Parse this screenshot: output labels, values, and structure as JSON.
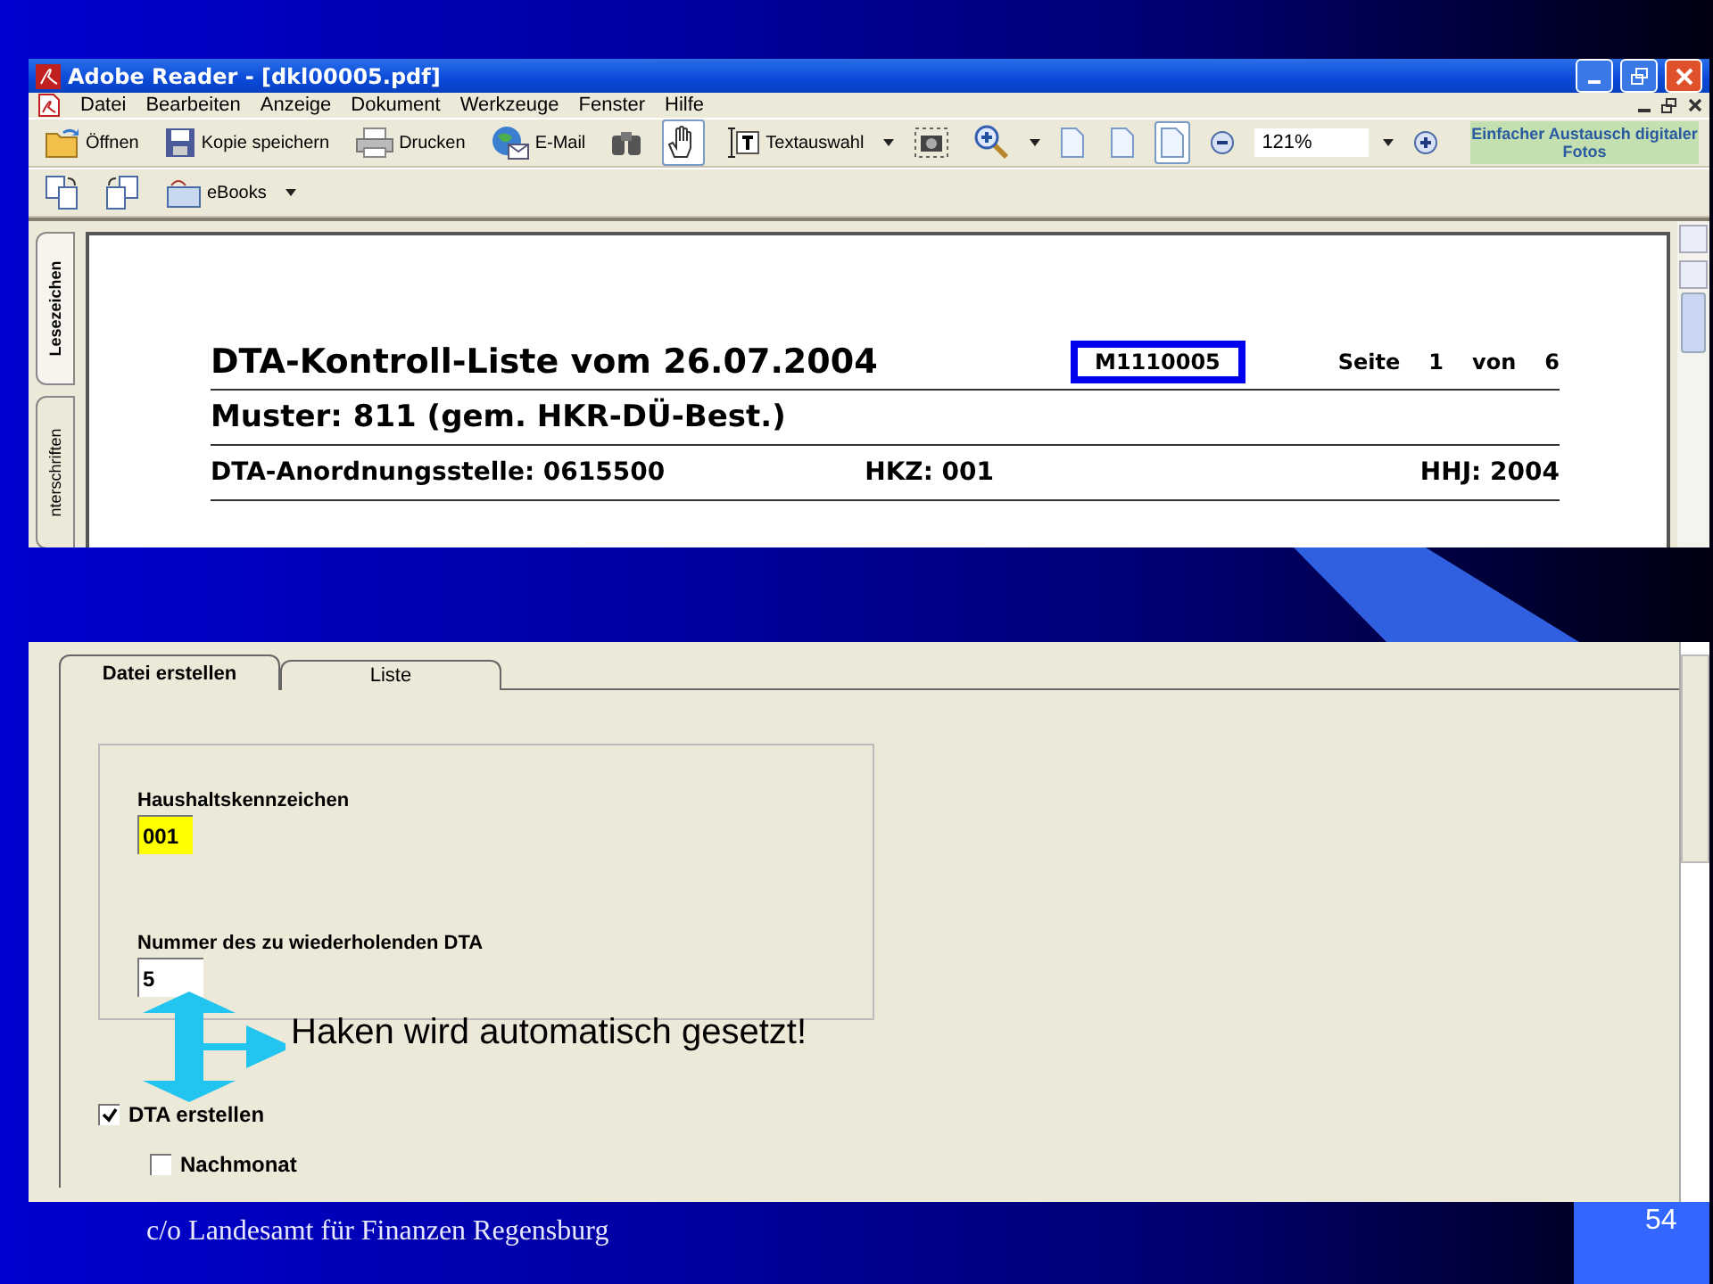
{
  "reader_window": {
    "title": "Adobe Reader - [dkl00005.pdf]",
    "menu": [
      "Datei",
      "Bearbeiten",
      "Anzeige",
      "Dokument",
      "Werkzeuge",
      "Fenster",
      "Hilfe"
    ],
    "toolbar": [
      {
        "kind": "folder",
        "label": "Öffnen"
      },
      {
        "kind": "floppy",
        "label": "Kopie speichern"
      },
      {
        "kind": "printer",
        "label": "Drucken"
      },
      {
        "kind": "mail",
        "label": "E-Mail"
      },
      {
        "kind": "binoculars"
      },
      {
        "kind": "hand",
        "selected": true
      },
      {
        "kind": "text-select",
        "label": "Textauswahl",
        "selected": false
      },
      {
        "kind": "camera",
        "selected": false
      },
      {
        "kind": "zoom-in",
        "selected": false
      },
      {
        "kind": "page",
        "selected": false
      },
      {
        "kind": "page",
        "selected": false
      },
      {
        "kind": "page",
        "selected": true
      },
      {
        "kind": "zoom-out"
      },
      {
        "kind": "zoom-field",
        "label": "121%"
      },
      {
        "kind": "zoom-plus"
      }
    ],
    "promo": "Einfacher Austausch digitaler Fotos",
    "toolbar2": [
      {
        "kind": "page-prev"
      },
      {
        "kind": "page-next"
      },
      {
        "kind": "ebooks",
        "label": "eBooks"
      }
    ],
    "side_tabs": [
      {
        "label": "Lesezeichen",
        "selected": true
      },
      {
        "label": "nterschriften",
        "selected": false
      }
    ],
    "document": {
      "title": "DTA-Kontroll-Liste vom 26.07.2004",
      "code": "M1110005",
      "page_label": "Seite",
      "page": "1",
      "of_label": "von",
      "pages": "6",
      "line2": "Muster: 811 (gem. HKR-DÜ-Best.)",
      "line3": [
        "DTA-Anordnungsstelle: 0615500",
        "HKZ: 001",
        "HHJ: 2004"
      ]
    }
  },
  "dialog": {
    "tabs": [
      {
        "label": "Datei erstellen",
        "selected": true
      },
      {
        "label": "Liste",
        "selected": false
      }
    ],
    "fields": [
      {
        "label": "Haushaltskennzeichen",
        "value": "001",
        "highlighted": true
      },
      {
        "label": "Nummer des zu wiederholenden DTA",
        "value": "5",
        "highlighted": false
      }
    ],
    "checkboxes": [
      {
        "label": "DTA erstellen",
        "checked": true
      },
      {
        "label": "Nachmonat",
        "checked": false
      }
    ]
  },
  "annotation": "Haken wird automatisch gesetzt!",
  "footer": "c/o Landesamt für Finanzen Regensburg",
  "slide_number": "54"
}
